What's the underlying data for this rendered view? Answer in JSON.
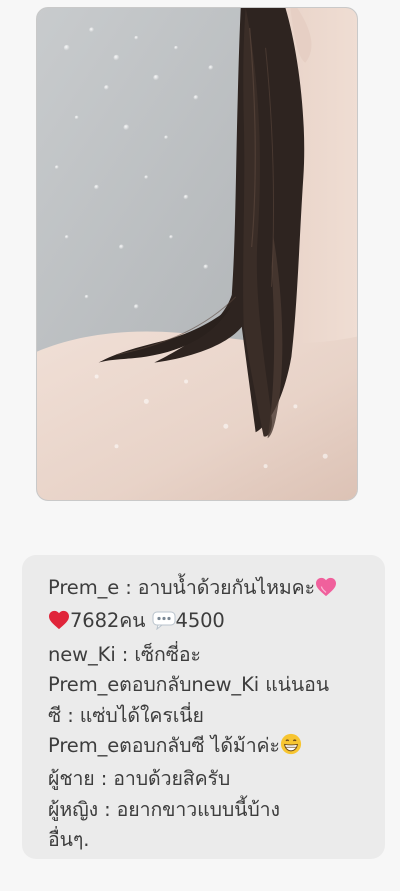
{
  "photo": {
    "icon": "shower-hair-photo"
  },
  "caption": {
    "lines": [
      {
        "text": "Prem_e : อาบน้ำด้วยกันไหมคะ",
        "icon": "pink-heart-icon"
      },
      {
        "heart_icon": "red-heart-icon",
        "count_text": "7682คน",
        "comment_icon": "speech-bubble-icon",
        "comment_count": "4500"
      },
      {
        "text": "new_Ki : เซ็กซี่อะ"
      },
      {
        "text": "Prem_eตอบกลับnew_Ki แน่นอน"
      },
      {
        "text": "ซี : แซ่บได้ใครเนี่ย"
      },
      {
        "text": "Prem_eตอบกลับซี ได้ม้าค่ะ",
        "icon": "grinning-face-icon"
      },
      {
        "text": "ผู้ชาย : อาบด้วยสิครับ"
      },
      {
        "text": "ผู้หญิง : อยากขาวแบบนี้บ้าง"
      },
      {
        "text": "อื่นๆ."
      }
    ]
  },
  "colors": {
    "background": "#f7f7f7",
    "card": "#ebebeb",
    "text": "#3d3d3d",
    "pink_heart": "#f0609c",
    "red_heart": "#e0253a"
  }
}
